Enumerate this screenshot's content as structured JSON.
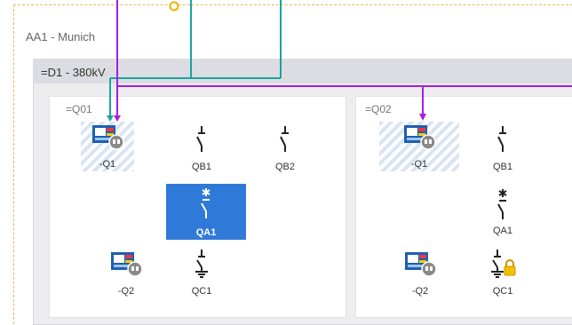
{
  "substation": {
    "label": "AA1 - Munich"
  },
  "voltage_level": {
    "label": "=D1 - 380kV"
  },
  "bays": [
    {
      "label": "=Q01",
      "devices": [
        {
          "label": "-Q1",
          "type": "ied"
        },
        {
          "label": "QB1",
          "type": "disconnector"
        },
        {
          "label": "QB2",
          "type": "disconnector"
        },
        {
          "label": "QA1",
          "type": "circuit-breaker",
          "selected": true
        },
        {
          "label": "-Q2",
          "type": "ied"
        },
        {
          "label": "QC1",
          "type": "earth-switch"
        }
      ]
    },
    {
      "label": "=Q02",
      "devices": [
        {
          "label": "-Q1",
          "type": "ied"
        },
        {
          "label": "QB1",
          "type": "disconnector"
        },
        {
          "label": "QA1",
          "type": "circuit-breaker"
        },
        {
          "label": "-Q2",
          "type": "ied"
        },
        {
          "label": "QC1",
          "type": "earth-switch",
          "locked": true
        }
      ]
    }
  ],
  "colors": {
    "teal": "#1aa39e",
    "purple": "#a51de0",
    "selected": "#2f7ad8",
    "orange": "#e8b400"
  }
}
